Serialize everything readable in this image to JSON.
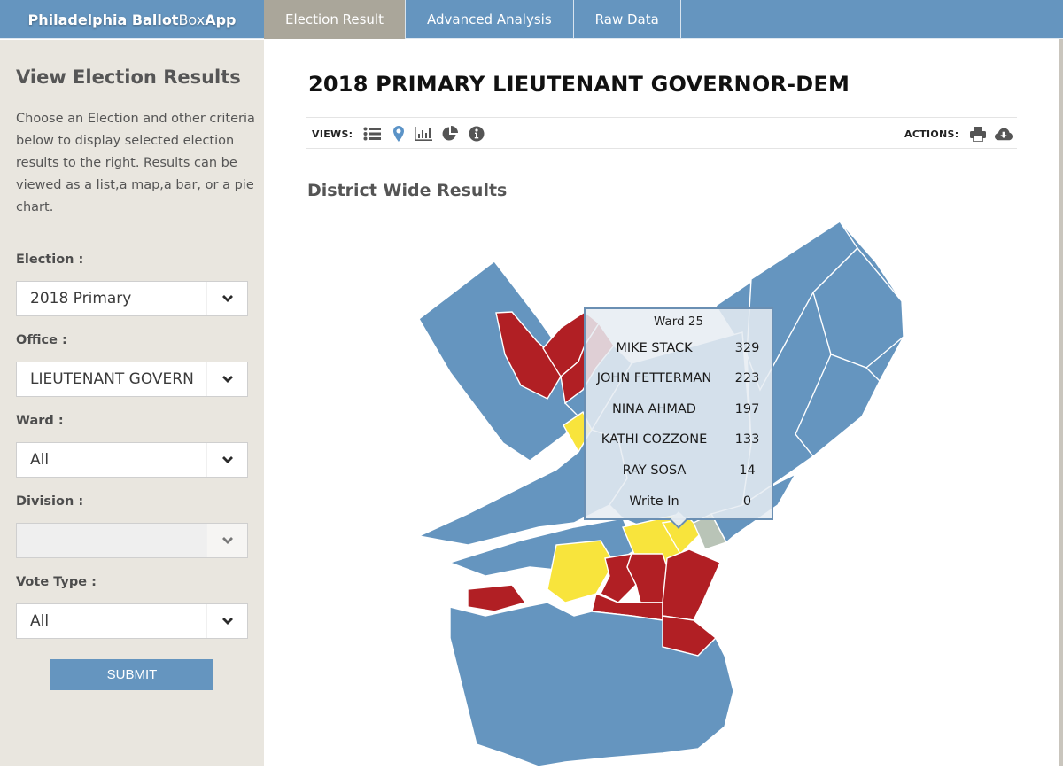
{
  "header": {
    "brand_bold_1": "Philadelphia Ballot",
    "brand_light": "Box",
    "brand_bold_2": "App",
    "tabs": [
      {
        "label": "Election Result",
        "active": true
      },
      {
        "label": "Advanced Analysis",
        "active": false
      },
      {
        "label": "Raw Data",
        "active": false
      }
    ]
  },
  "sidebar": {
    "title": "View Election Results",
    "description": "Choose an Election and other criteria below to display selected election results to the right. Results can be viewed as a list,a map,a bar, or a pie chart.",
    "fields": [
      {
        "label": "Election :",
        "value": "2018 Primary",
        "disabled": false
      },
      {
        "label": "Office :",
        "value": "LIEUTENANT GOVERN",
        "disabled": false
      },
      {
        "label": "Ward :",
        "value": "All",
        "disabled": false
      },
      {
        "label": "Division :",
        "value": "",
        "disabled": true
      },
      {
        "label": "Vote Type :",
        "value": "All",
        "disabled": false
      }
    ],
    "submit_label": "SUBMIT"
  },
  "main": {
    "title": "2018 PRIMARY LIEUTENANT GOVERNOR-DEM",
    "views_label": "VIEWS:",
    "views_icons": [
      "list-icon",
      "map-marker-icon",
      "bar-chart-icon",
      "pie-chart-icon",
      "info-icon"
    ],
    "active_view": "map-marker-icon",
    "actions_label": "ACTIONS:",
    "actions_icons": [
      "print-icon",
      "cloud-download-icon"
    ],
    "section_title": "District Wide Results"
  },
  "map": {
    "colors": {
      "blue": "#6595bf",
      "red": "#b11f24",
      "yellow": "#f8e43c",
      "gray": "#b9c4b7"
    },
    "tooltip": {
      "title": "Ward 25",
      "rows": [
        {
          "name": "MIKE STACK",
          "votes": "329"
        },
        {
          "name": "JOHN FETTERMAN",
          "votes": "223"
        },
        {
          "name": "NINA AHMAD",
          "votes": "197"
        },
        {
          "name": "KATHI COZZONE",
          "votes": "133"
        },
        {
          "name": "RAY SOSA",
          "votes": "14"
        },
        {
          "name": "Write In",
          "votes": "0"
        }
      ]
    }
  }
}
